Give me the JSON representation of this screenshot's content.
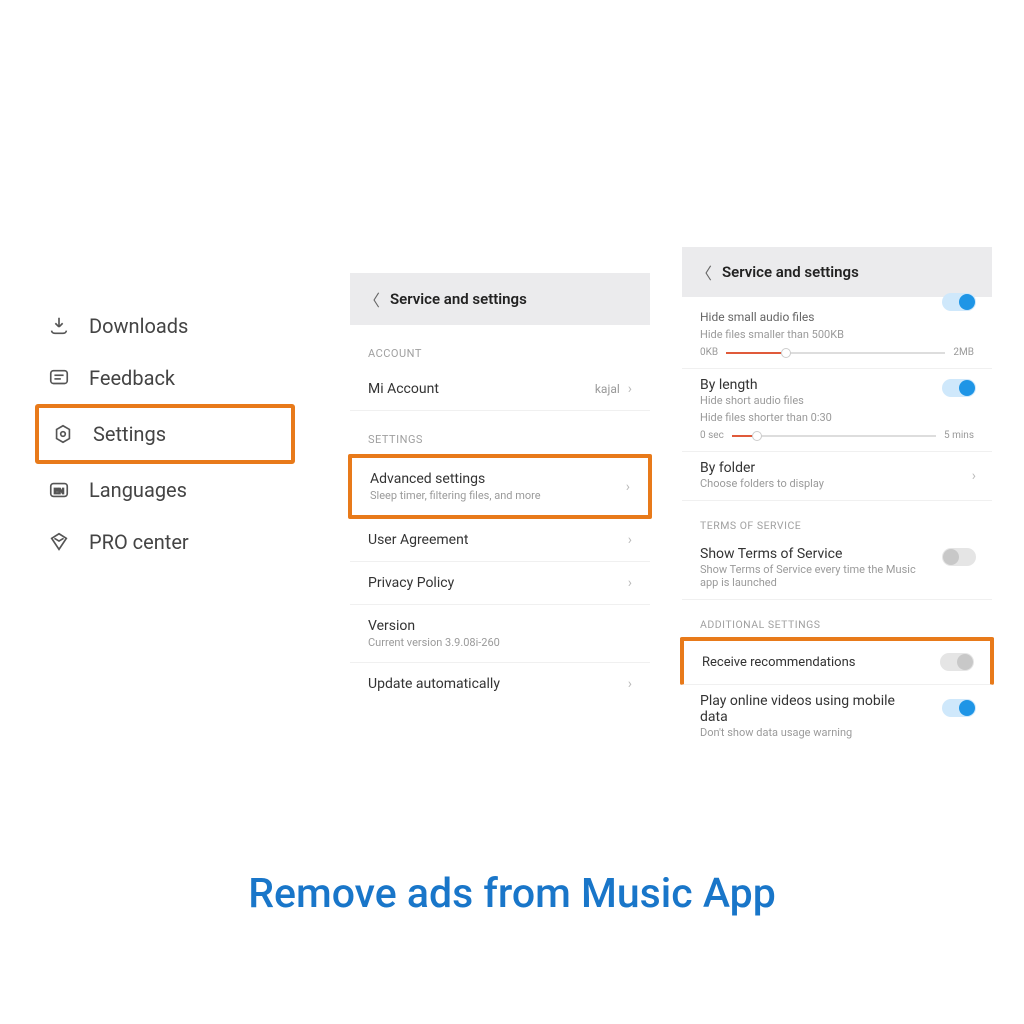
{
  "menu": {
    "downloads": "Downloads",
    "feedback": "Feedback",
    "settings": "Settings",
    "languages": "Languages",
    "pro_center": "PRO center"
  },
  "panel2": {
    "header": "Service and settings",
    "account_section": "ACCOUNT",
    "mi_account": "Mi Account",
    "mi_account_value": "kajal",
    "settings_section": "SETTINGS",
    "advanced": "Advanced settings",
    "advanced_sub": "Sleep timer, filtering files, and more",
    "user_agreement": "User Agreement",
    "privacy_policy": "Privacy Policy",
    "version": "Version",
    "version_sub": "Current version 3.9.08i-260",
    "update_auto": "Update automatically"
  },
  "panel3": {
    "header": "Service and settings",
    "hide_small": "Hide small audio files",
    "hide_small_sub": "Hide files smaller than 500KB",
    "slider1_left": "0KB",
    "slider1_right": "2MB",
    "by_length": "By length",
    "by_length_sub": "Hide short audio files",
    "by_length_sub2": "Hide files shorter than 0:30",
    "slider2_left": "0 sec",
    "slider2_right": "5 mins",
    "by_folder": "By folder",
    "by_folder_sub": "Choose folders to display",
    "tos_section": "TERMS OF SERVICE",
    "show_tos": "Show Terms of Service",
    "show_tos_sub": "Show Terms of Service every time the Music app is launched",
    "additional_section": "ADDITIONAL SETTINGS",
    "receive_rec": "Receive recommendations",
    "play_mobile": "Play online videos using mobile data",
    "play_mobile_sub": "Don't show data usage warning"
  },
  "caption": "Remove ads from Music App"
}
